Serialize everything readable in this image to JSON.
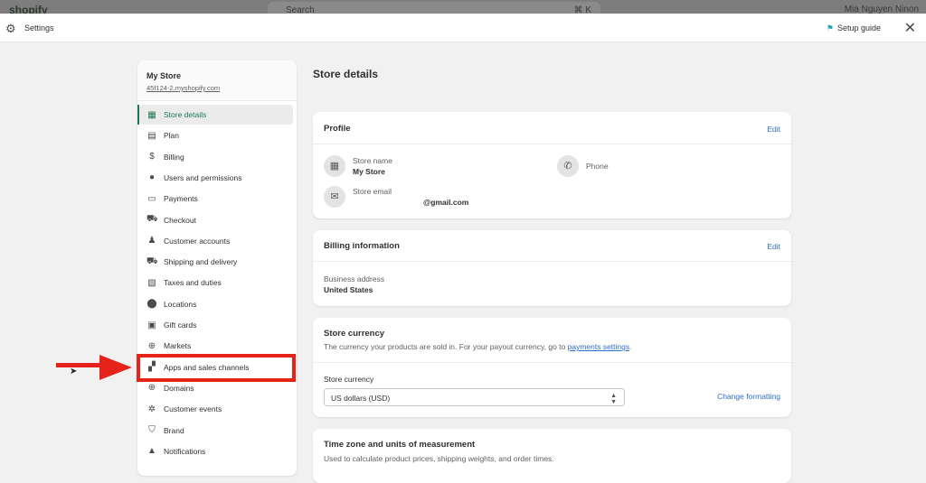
{
  "topbar": {
    "logo": "shopify",
    "search": "Search",
    "shortcut": "⌘ K",
    "user": "Mia Nguyen Ninon"
  },
  "header": {
    "title": "Settings",
    "setup_guide": "Setup guide",
    "icons": {
      "settings": "gear-icon",
      "setup": "flag-icon",
      "close": "close-icon"
    }
  },
  "sidebar": {
    "store_name": "My Store",
    "store_url": "45f124-2.myshopify.com",
    "items": [
      {
        "label": "Store details",
        "icon": "store-icon",
        "glyph": "▦",
        "active": true
      },
      {
        "label": "Plan",
        "icon": "plan-icon",
        "glyph": "▤"
      },
      {
        "label": "Billing",
        "icon": "billing-icon",
        "glyph": "$"
      },
      {
        "label": "Users and permissions",
        "icon": "user-circle-icon",
        "glyph": "●"
      },
      {
        "label": "Payments",
        "icon": "payments-icon",
        "glyph": "▭"
      },
      {
        "label": "Checkout",
        "icon": "cart-icon",
        "glyph": "⛟"
      },
      {
        "label": "Customer accounts",
        "icon": "person-icon",
        "glyph": "♟"
      },
      {
        "label": "Shipping and delivery",
        "icon": "truck-icon",
        "glyph": "⛟"
      },
      {
        "label": "Taxes and duties",
        "icon": "receipt-icon",
        "glyph": "▧"
      },
      {
        "label": "Locations",
        "icon": "location-pin-icon",
        "glyph": "⬤"
      },
      {
        "label": "Gift cards",
        "icon": "gift-icon",
        "glyph": "▣"
      },
      {
        "label": "Markets",
        "icon": "globe-icon",
        "glyph": "⊕"
      },
      {
        "label": "Apps and sales channels",
        "icon": "apps-icon",
        "glyph": "▞"
      },
      {
        "label": "Domains",
        "icon": "globe-icon",
        "glyph": "⊕"
      },
      {
        "label": "Customer events",
        "icon": "events-icon",
        "glyph": "✲"
      },
      {
        "label": "Brand",
        "icon": "brand-icon",
        "glyph": "⛉"
      },
      {
        "label": "Notifications",
        "icon": "bell-icon",
        "glyph": "▲"
      }
    ]
  },
  "main": {
    "title": "Store details",
    "profile": {
      "title": "Profile",
      "edit": "Edit",
      "store_name_label": "Store name",
      "store_name": "My Store",
      "phone_label": "Phone",
      "email_label": "Store email",
      "email": "@gmail.com"
    },
    "billing": {
      "title": "Billing information",
      "edit": "Edit",
      "address_label": "Business address",
      "address": "United States"
    },
    "currency": {
      "title": "Store currency",
      "desc": "The currency your products are sold in. For your payout currency, go to ",
      "desc_link": "payments settings",
      "desc_end": ".",
      "field_label": "Store currency",
      "selected": "US dollars (USD)",
      "change": "Change formatting"
    },
    "timezone": {
      "title": "Time zone and units of measurement",
      "desc": "Used to calculate product prices, shipping weights, and order times."
    }
  },
  "annotation": {
    "color": "#e5231b"
  }
}
